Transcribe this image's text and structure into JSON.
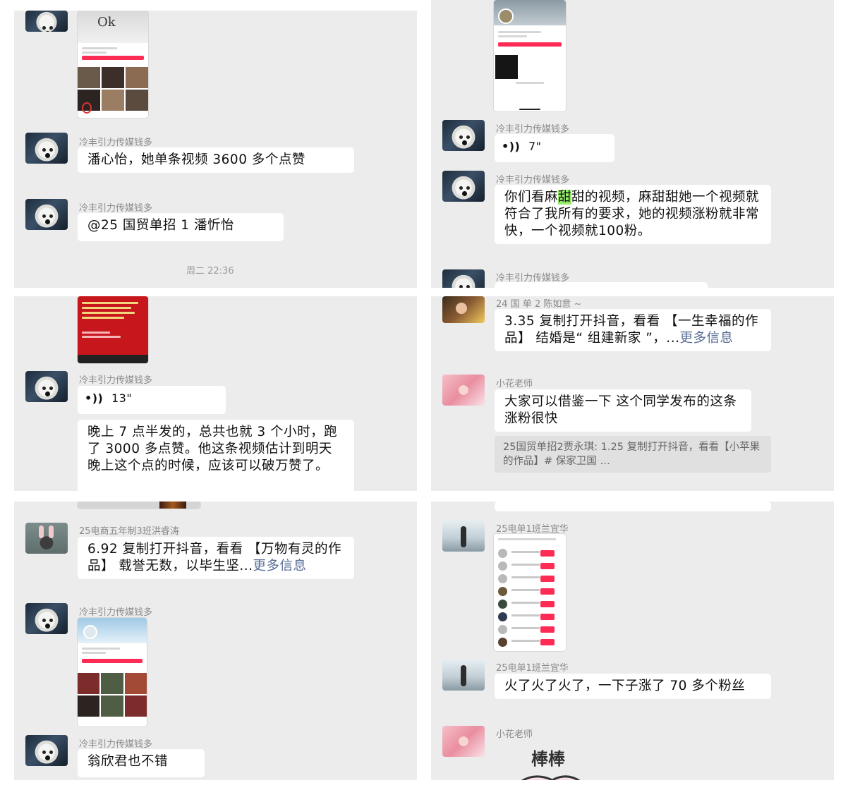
{
  "names": {
    "dog": "冷丰引力传媒钱多",
    "hong": "25电商五年制3班洪睿涛",
    "lan": "25电单1班兰宜华",
    "teacher": "小花老师",
    "chen_cut": "24 国 单 2 陈如意 ~"
  },
  "panel1": {
    "msg1": "潘心怡，她单条视频 3600 多个点赞",
    "msg2": "@25 国贸单招 1 潘忻怡",
    "time": "周二 22:36",
    "shot_text": "Ok"
  },
  "panel2": {
    "voice1": "7\"",
    "msg_part1": "你们看麻",
    "msg_highlight": "甜",
    "msg_part2": "甜的视频，麻甜甜她一个视频就符合了我所有的要求，她的视频涨粉就非常快，一个视频就100粉。"
  },
  "panel3": {
    "voice2": "13\"",
    "msg": "晚上 7 点半发的，总共也就 3 个小时，跑了 3000 多点赞。他这条视频估计到明天晚上这个点的时候，应该可以破万赞了。"
  },
  "panel4": {
    "msg_part": "3.35 复制打开抖音，看看 【一生幸福的作品】 结婚是“ 组建新家 ”，...",
    "more": "更多信息",
    "teacher_msg": "大家可以借鉴一下 这个同学发布的这条涨粉很快",
    "quote": "25国贸单招2贾永琪: 1.25 复制打开抖音，看看【小苹果的作品】# 保家卫国 …"
  },
  "panel5": {
    "msg_part": "6.92 复制打开抖音，看看 【万物有灵的作品】 载誉无数，以毕生坚...",
    "more": "更多信息",
    "msg2": "翁欣君也不错"
  },
  "panel6": {
    "msg": "火了火了火了，一下子涨了 70 多个粉丝",
    "sticker": "棒棒"
  },
  "icons": {
    "voice": "voice-wave-icon"
  },
  "colors": {
    "panel_bg": "#ececec",
    "bubble_bg": "#ffffff",
    "link": "#576b95",
    "highlight": "#95ec69",
    "tiktok_red": "#fe2c55"
  }
}
